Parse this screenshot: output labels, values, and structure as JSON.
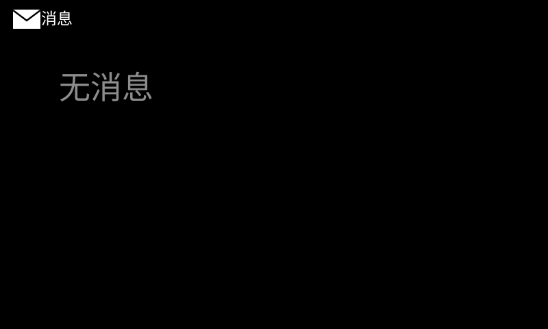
{
  "header": {
    "icon": "mail-icon",
    "title": "消息"
  },
  "content": {
    "empty_message": "无消息"
  },
  "colors": {
    "background": "#000000",
    "header_text": "#ffffff",
    "empty_text": "#8c8c8c"
  }
}
